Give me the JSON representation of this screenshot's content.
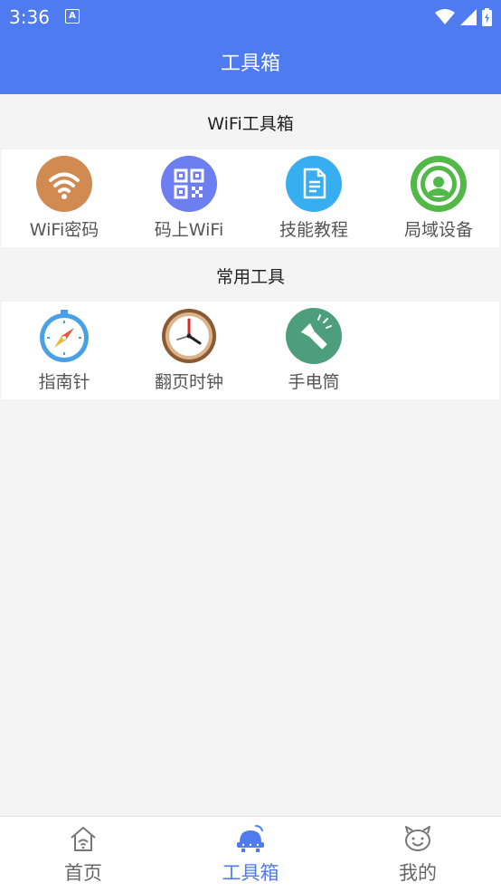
{
  "status_bar": {
    "time": "3:36",
    "notification_letter": "A"
  },
  "app_bar": {
    "title": "工具箱"
  },
  "sections": [
    {
      "title": "WiFi工具箱",
      "items": [
        {
          "label": "WiFi密码",
          "icon": "wifi-icon",
          "color": "#d08a52"
        },
        {
          "label": "码上WiFi",
          "icon": "qr-code-icon",
          "color": "#6c7ef0"
        },
        {
          "label": "技能教程",
          "icon": "document-icon",
          "color": "#36aef0"
        },
        {
          "label": "局域设备",
          "icon": "network-device-icon",
          "color": "#52b848"
        }
      ]
    },
    {
      "title": "常用工具",
      "items": [
        {
          "label": "指南针",
          "icon": "compass-icon",
          "color": "#4aa0e4"
        },
        {
          "label": "翻页时钟",
          "icon": "clock-icon",
          "color": "#a8754e"
        },
        {
          "label": "手电筒",
          "icon": "flashlight-icon",
          "color": "#4d9e7c"
        }
      ]
    }
  ],
  "bottom_nav": [
    {
      "label": "首页",
      "icon": "home-icon",
      "active": false
    },
    {
      "label": "工具箱",
      "icon": "toolbox-icon",
      "active": true
    },
    {
      "label": "我的",
      "icon": "profile-icon",
      "active": false
    }
  ],
  "colors": {
    "primary": "#4f7bf0",
    "background": "#f4f4f4",
    "label": "#555555"
  }
}
